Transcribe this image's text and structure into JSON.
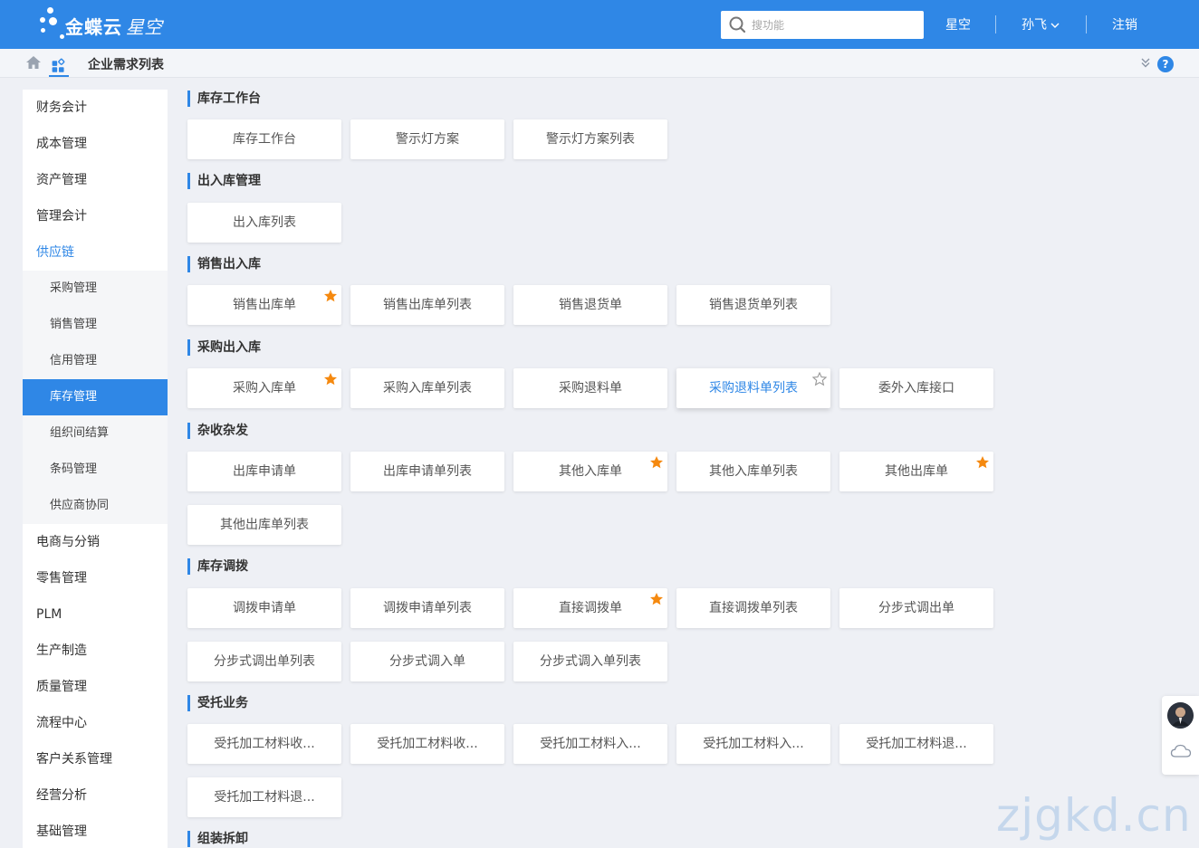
{
  "header": {
    "logo_text": "金蝶云",
    "logo_sub": "星空",
    "search_placeholder": "搜功能",
    "nav": [
      "星空",
      "孙飞",
      "注销"
    ]
  },
  "breadcrumb": {
    "title": "企业需求列表"
  },
  "sidebar": {
    "items": [
      "财务会计",
      "成本管理",
      "资产管理",
      "管理会计",
      "供应链"
    ],
    "sub_items": [
      "采购管理",
      "销售管理",
      "信用管理",
      "库存管理",
      "组织间结算",
      "条码管理",
      "供应商协同"
    ],
    "items_after": [
      "电商与分销",
      "零售管理",
      "PLM",
      "生产制造",
      "质量管理",
      "流程中心",
      "客户关系管理",
      "经营分析",
      "基础管理"
    ]
  },
  "sections": [
    {
      "title": "库存工作台",
      "cards": [
        "库存工作台",
        "警示灯方案",
        "警示灯方案列表"
      ]
    },
    {
      "title": "出入库管理",
      "cards": [
        "出入库列表"
      ]
    },
    {
      "title": "销售出入库",
      "cards": [
        "销售出库单",
        "销售出库单列表",
        "销售退货单",
        "销售退货单列表"
      ]
    },
    {
      "title": "采购出入库",
      "cards": [
        "采购入库单",
        "采购入库单列表",
        "采购退料单",
        "采购退料单列表",
        "委外入库接口"
      ]
    },
    {
      "title": "杂收杂发",
      "cards": [
        "出库申请单",
        "出库申请单列表",
        "其他入库单",
        "其他入库单列表",
        "其他出库单",
        "其他出库单列表"
      ]
    },
    {
      "title": "库存调拨",
      "cards": [
        "调拨申请单",
        "调拨申请单列表",
        "直接调拨单",
        "直接调拨单列表",
        "分步式调出单",
        "分步式调出单列表",
        "分步式调入单",
        "分步式调入单列表"
      ]
    },
    {
      "title": "受托业务",
      "cards": [
        "受托加工材料收...",
        "受托加工材料收...",
        "受托加工材料入...",
        "受托加工材料入...",
        "受托加工材料退...",
        "受托加工材料退..."
      ]
    },
    {
      "title": "组装拆卸",
      "cards": []
    }
  ],
  "watermark": "zjgkd.cn",
  "colors": {
    "primary": "#2f87e6",
    "star": "#f5890f"
  }
}
